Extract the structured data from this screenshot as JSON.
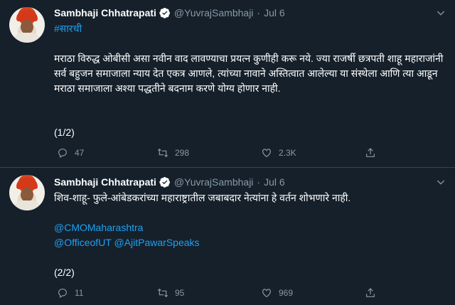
{
  "tweets": [
    {
      "author_name": "Sambhaji Chhatrapati",
      "handle": "@YuvrajSambhaji",
      "separator": "·",
      "date": "Jul 6",
      "hashtag": "#सारथी",
      "body": "मराठा विरुद्ध ओबीसी असा नवीन वाद लावण्याचा प्रयत्न कुणीही करू नये. ज्या राजर्षी छत्रपती शाहू महाराजांनी सर्व बहुजन समाजाला न्याय देत एकत्र आणले, त्यांच्या नावाने अस्तित्वात आलेल्या या संस्थेला आणि त्या आडून मराठा समाजाला अश्या पद्धतीने बदनाम करणे योग्य होणार नाही.",
      "footer": "(1/2)",
      "replies": "47",
      "retweets": "298",
      "likes": "2.3K"
    },
    {
      "author_name": "Sambhaji Chhatrapati",
      "handle": "@YuvrajSambhaji",
      "separator": "·",
      "date": "Jul 6",
      "body": "शिव-शाहू- फुले-आंबेडकरांच्या महाराष्ट्रातील जबाबदार नेत्यांना हे वर्तन शोभणारे नाही.",
      "mention1": "@CMOMaharashtra",
      "mention2": "@OfficeofUT",
      "mention3": "@AjitPawarSpeaks",
      "footer": "(2/2)",
      "replies": "11",
      "retweets": "95",
      "likes": "969"
    }
  ],
  "colors": {
    "background": "#15202b",
    "link": "#1da1f2",
    "muted": "#8899a6",
    "divider": "#38444d"
  },
  "icons": [
    "verified-badge-icon",
    "chevron-down-icon",
    "reply-icon",
    "retweet-icon",
    "like-icon",
    "share-icon"
  ]
}
